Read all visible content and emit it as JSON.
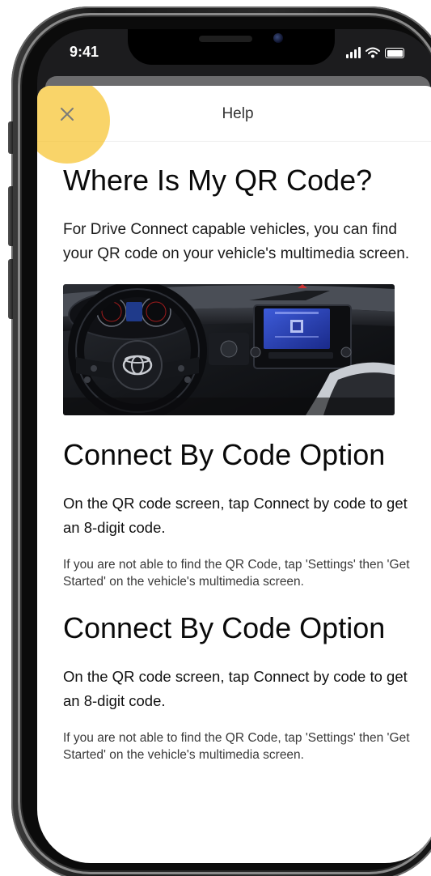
{
  "status_bar": {
    "time": "9:41"
  },
  "header": {
    "title": "Help",
    "close_icon": "close-icon"
  },
  "sections": [
    {
      "heading": "Where Is My QR Code?",
      "body": "For Drive Connect capable vehicles, you can find your QR code on your vehicle's multimedia screen."
    },
    {
      "heading": "Connect By Code Option",
      "lead": "On the QR code screen, tap Connect by code to get an 8-digit code.",
      "note": "If you are not able to find the QR Code, tap 'Settings' then 'Get Started' on the vehicle's multimedia screen."
    },
    {
      "heading": "Connect By Code Option",
      "lead": "On the QR code screen, tap Connect by code to get an 8-digit code.",
      "note": "If you are not able to find the QR Code, tap 'Settings' then 'Get Started' on the vehicle's multimedia screen."
    }
  ],
  "colors": {
    "highlight": "#F6C42F",
    "close_icon": "#7a7a7a",
    "sheet_background": "#FFFFFF",
    "text": "#0A0A0A"
  }
}
